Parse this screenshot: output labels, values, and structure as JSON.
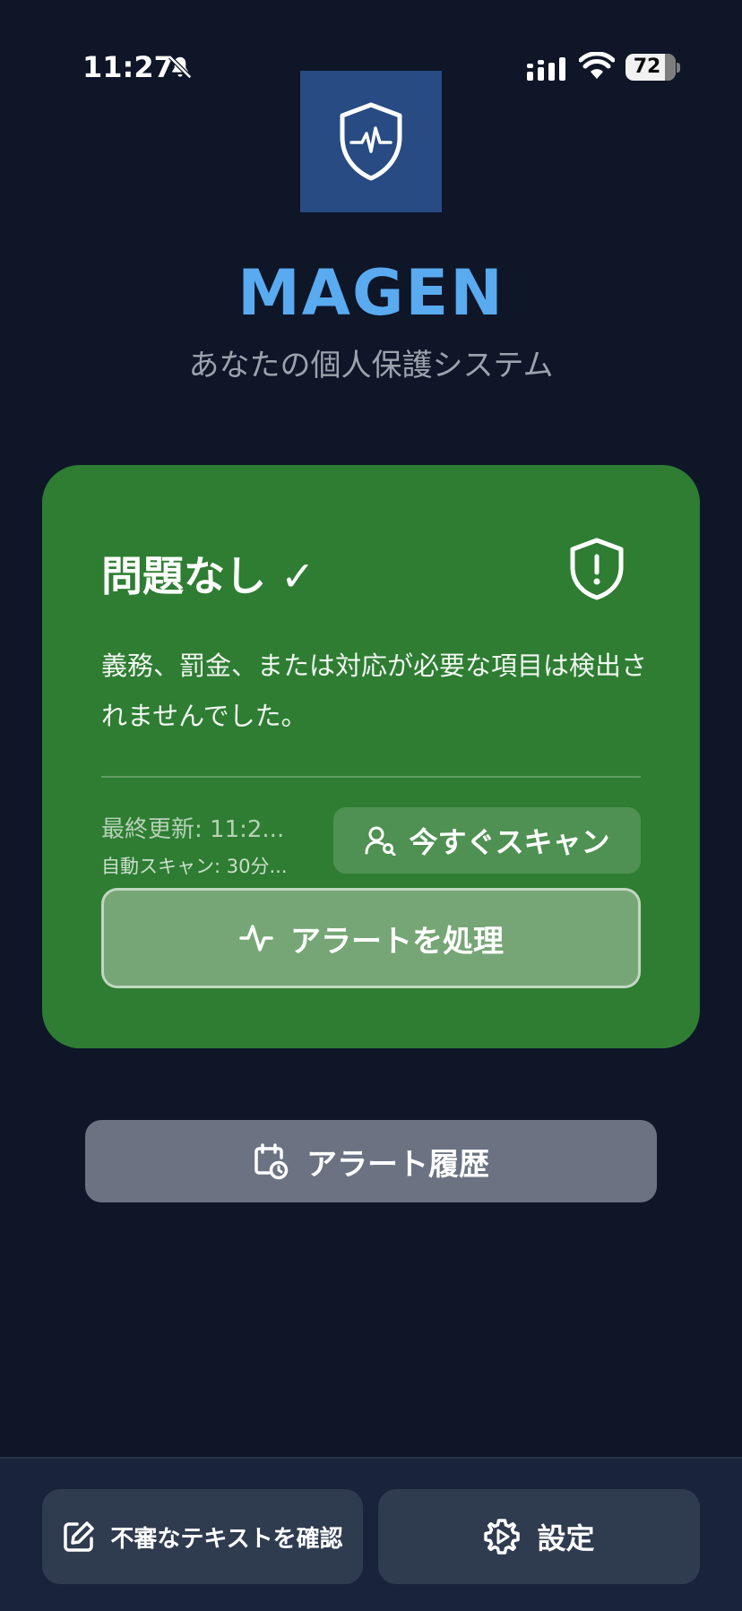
{
  "status_bar": {
    "time": "11:27",
    "battery": "72",
    "icons": [
      "bell-slash-icon",
      "cellular-signal-icon",
      "wifi-icon",
      "battery-icon"
    ]
  },
  "header": {
    "logo_icon": "shield-heartbeat-icon",
    "title": "MAGEN",
    "subtitle": "あなたの個人保護システム"
  },
  "status_card": {
    "title": "問題なし ✓",
    "icon": "shield-alert-icon",
    "description": "義務、罰金、または対応が必要な項目は検出されませんでした。",
    "last_updated": "最終更新: 11:2...",
    "auto_scan": "自動スキャン: 30分...",
    "scan_button_label": "今すぐスキャン",
    "scan_button_icon": "user-search-icon",
    "process_button_label": "アラートを処理",
    "process_button_icon": "activity-icon"
  },
  "history": {
    "label": "アラート履歴",
    "icon": "calendar-clock-icon"
  },
  "bottom_bar": {
    "check_text_label": "不審なテキストを確認",
    "check_text_icon": "edit-icon",
    "settings_label": "設定",
    "settings_icon": "gear-icon"
  },
  "colors": {
    "background": "#0e1628",
    "accent": "#5aaaf0",
    "card_green": "#2e7d32",
    "logo_blue": "#274b82",
    "history_button": "#6b7382",
    "bottom_button": "#2f3b4f"
  }
}
